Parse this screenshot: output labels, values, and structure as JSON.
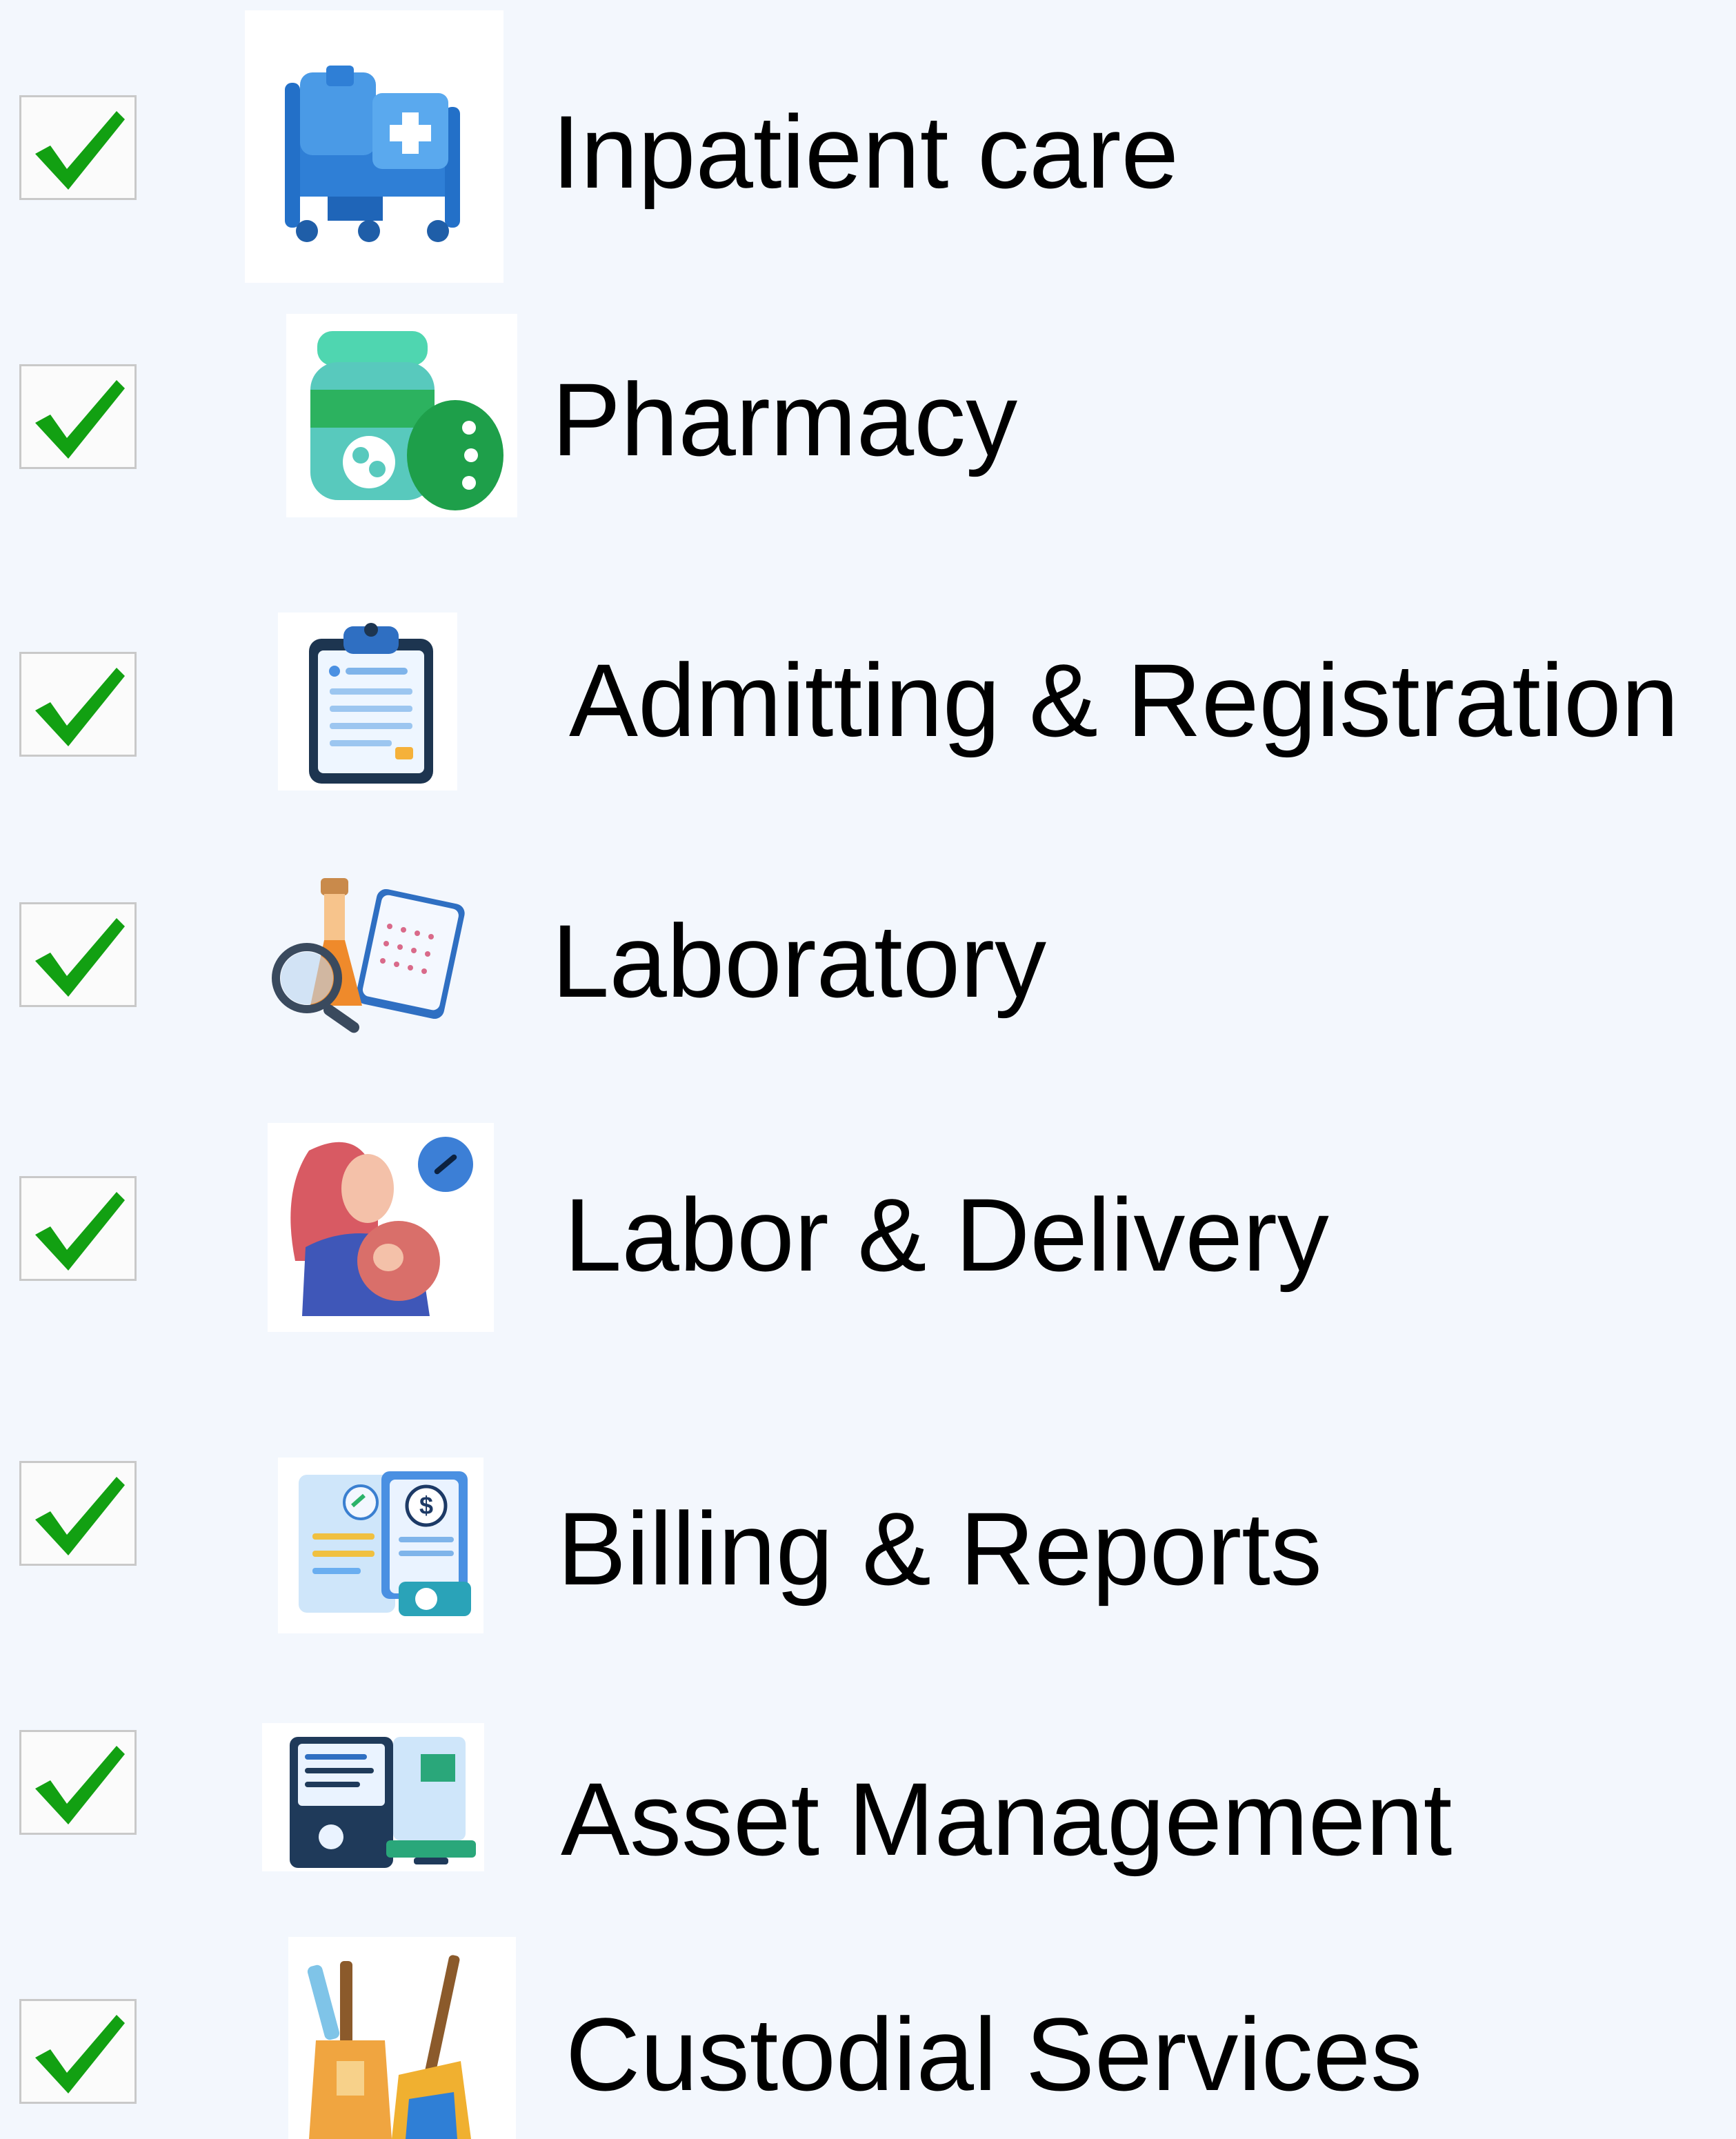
{
  "colors": {
    "background": "#f3f7fd",
    "check": "#12a012",
    "checkbox_border": "#c9c9c9",
    "text": "#000000"
  },
  "items": [
    {
      "label": "Inpatient care",
      "checked": true,
      "icon": "hospital-bed-icon"
    },
    {
      "label": "Pharmacy",
      "checked": true,
      "icon": "medicine-bottle-icon"
    },
    {
      "label": "Admitting & Registration",
      "checked": true,
      "icon": "clipboard-icon"
    },
    {
      "label": "Laboratory",
      "checked": true,
      "icon": "lab-flask-magnifier-icon"
    },
    {
      "label": "Labor & Delivery",
      "checked": true,
      "icon": "pregnant-woman-icon"
    },
    {
      "label": "Billing & Reports",
      "checked": true,
      "icon": "billing-documents-icon"
    },
    {
      "label": "Asset Management",
      "checked": true,
      "icon": "computer-devices-icon"
    },
    {
      "label": "Custodial Services",
      "checked": true,
      "icon": "cleaning-supplies-icon"
    }
  ]
}
